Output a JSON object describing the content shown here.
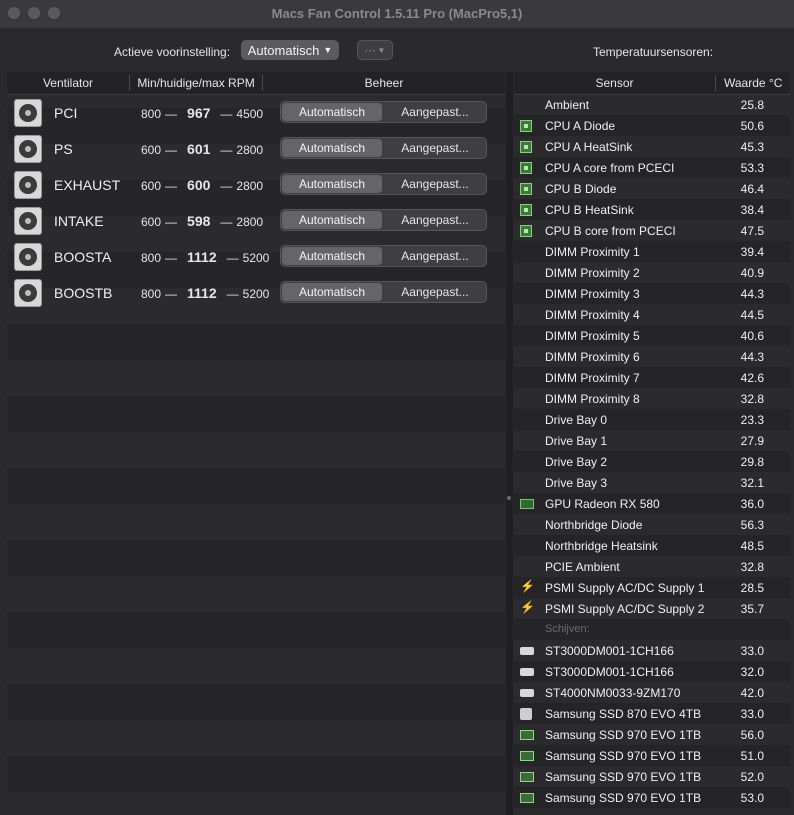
{
  "window": {
    "title": "Macs Fan Control 1.5.11 Pro (MacPro5,1)"
  },
  "toolbar": {
    "preset_label": "Actieve voorinstelling:",
    "preset_value": "Automatisch",
    "more_icon": "ellipsis-circle-icon",
    "temperature_label": "Temperatuursensoren:"
  },
  "fans": {
    "headers": {
      "fan": "Ventilator",
      "rpm": "Min/huidige/max RPM",
      "control": "Beheer"
    },
    "auto_label": "Automatisch",
    "custom_label": "Aangepast...",
    "items": [
      {
        "name": "PCI",
        "min": "800",
        "current": "967",
        "max": "4500"
      },
      {
        "name": "PS",
        "min": "600",
        "current": "601",
        "max": "2800"
      },
      {
        "name": "EXHAUST",
        "min": "600",
        "current": "600",
        "max": "2800"
      },
      {
        "name": "INTAKE",
        "min": "600",
        "current": "598",
        "max": "2800"
      },
      {
        "name": "BOOSTA",
        "min": "800",
        "current": "1112",
        "max": "5200"
      },
      {
        "name": "BOOSTB",
        "min": "800",
        "current": "1112",
        "max": "5200"
      }
    ]
  },
  "sensors": {
    "headers": {
      "sensor": "Sensor",
      "value": "Waarde °C"
    },
    "drives_section": "Schijven:",
    "items": [
      {
        "name": "Ambient",
        "value": "25.8",
        "icon": "none"
      },
      {
        "name": "CPU A Diode",
        "value": "50.6",
        "icon": "cpu-chip-icon"
      },
      {
        "name": "CPU A HeatSink",
        "value": "45.3",
        "icon": "cpu-chip-icon"
      },
      {
        "name": "CPU A core from PCECI",
        "value": "53.3",
        "icon": "cpu-chip-icon"
      },
      {
        "name": "CPU B Diode",
        "value": "46.4",
        "icon": "cpu-chip-icon"
      },
      {
        "name": "CPU B HeatSink",
        "value": "38.4",
        "icon": "cpu-chip-icon"
      },
      {
        "name": "CPU B core from PCECI",
        "value": "47.5",
        "icon": "cpu-chip-icon"
      },
      {
        "name": "DIMM Proximity 1",
        "value": "39.4",
        "icon": "none"
      },
      {
        "name": "DIMM Proximity 2",
        "value": "40.9",
        "icon": "none"
      },
      {
        "name": "DIMM Proximity 3",
        "value": "44.3",
        "icon": "none"
      },
      {
        "name": "DIMM Proximity 4",
        "value": "44.5",
        "icon": "none"
      },
      {
        "name": "DIMM Proximity 5",
        "value": "40.6",
        "icon": "none"
      },
      {
        "name": "DIMM Proximity 6",
        "value": "44.3",
        "icon": "none"
      },
      {
        "name": "DIMM Proximity 7",
        "value": "42.6",
        "icon": "none"
      },
      {
        "name": "DIMM Proximity 8",
        "value": "32.8",
        "icon": "none"
      },
      {
        "name": "Drive Bay 0",
        "value": "23.3",
        "icon": "none"
      },
      {
        "name": "Drive Bay 1",
        "value": "27.9",
        "icon": "none"
      },
      {
        "name": "Drive Bay 2",
        "value": "29.8",
        "icon": "none"
      },
      {
        "name": "Drive Bay 3",
        "value": "32.1",
        "icon": "none"
      },
      {
        "name": "GPU Radeon RX 580",
        "value": "36.0",
        "icon": "gpu-card-icon"
      },
      {
        "name": "Northbridge Diode",
        "value": "56.3",
        "icon": "none"
      },
      {
        "name": "Northbridge Heatsink",
        "value": "48.5",
        "icon": "none"
      },
      {
        "name": "PCIE Ambient",
        "value": "32.8",
        "icon": "none"
      },
      {
        "name": "PSMI Supply AC/DC Supply 1",
        "value": "28.5",
        "icon": "lightning-icon"
      },
      {
        "name": "PSMI Supply AC/DC Supply 2",
        "value": "35.7",
        "icon": "lightning-icon"
      }
    ],
    "drives": [
      {
        "name": "ST3000DM001-1CH166",
        "value": "33.0",
        "icon": "hard-drive-icon"
      },
      {
        "name": "ST3000DM001-1CH166",
        "value": "32.0",
        "icon": "hard-drive-icon"
      },
      {
        "name": "ST4000NM0033-9ZM170",
        "value": "42.0",
        "icon": "hard-drive-icon"
      },
      {
        "name": "Samsung SSD 870 EVO 4TB",
        "value": "33.0",
        "icon": "ssd-icon"
      },
      {
        "name": "Samsung SSD 970 EVO 1TB",
        "value": "56.0",
        "icon": "nvme-card-icon"
      },
      {
        "name": "Samsung SSD 970 EVO 1TB",
        "value": "51.0",
        "icon": "nvme-card-icon"
      },
      {
        "name": "Samsung SSD 970 EVO 1TB",
        "value": "52.0",
        "icon": "nvme-card-icon"
      },
      {
        "name": "Samsung SSD 970 EVO 1TB",
        "value": "53.0",
        "icon": "nvme-card-icon"
      }
    ]
  }
}
